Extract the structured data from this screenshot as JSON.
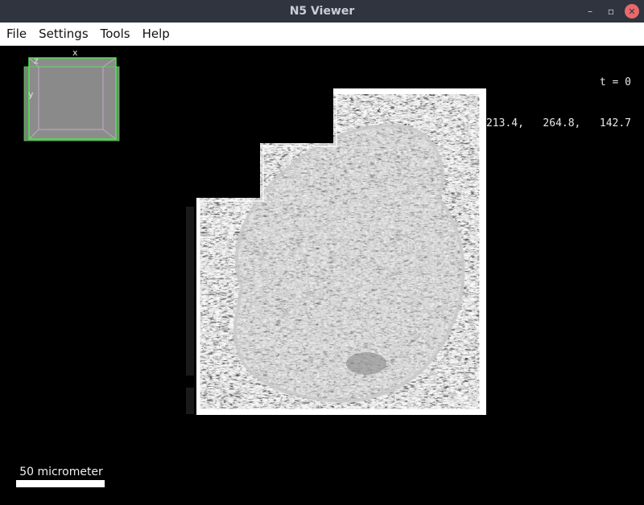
{
  "window": {
    "title": "N5 Viewer",
    "controls": {
      "minimize": "–",
      "maximize": "▫",
      "close": "✕"
    }
  },
  "menu": {
    "items": [
      "File",
      "Settings",
      "Tools",
      "Help"
    ]
  },
  "viewer": {
    "time_label": "t = 0",
    "coordinates": "213.4,   264.8,   142.7",
    "navigator": {
      "axis_x": "x",
      "axis_y": "y",
      "axis_z": "z",
      "frame_color": "#44ee44",
      "box_color": "#888888"
    },
    "scale_bar": {
      "label": "50 micrometer"
    },
    "image": {
      "description_icon": "em-slice-image"
    }
  }
}
